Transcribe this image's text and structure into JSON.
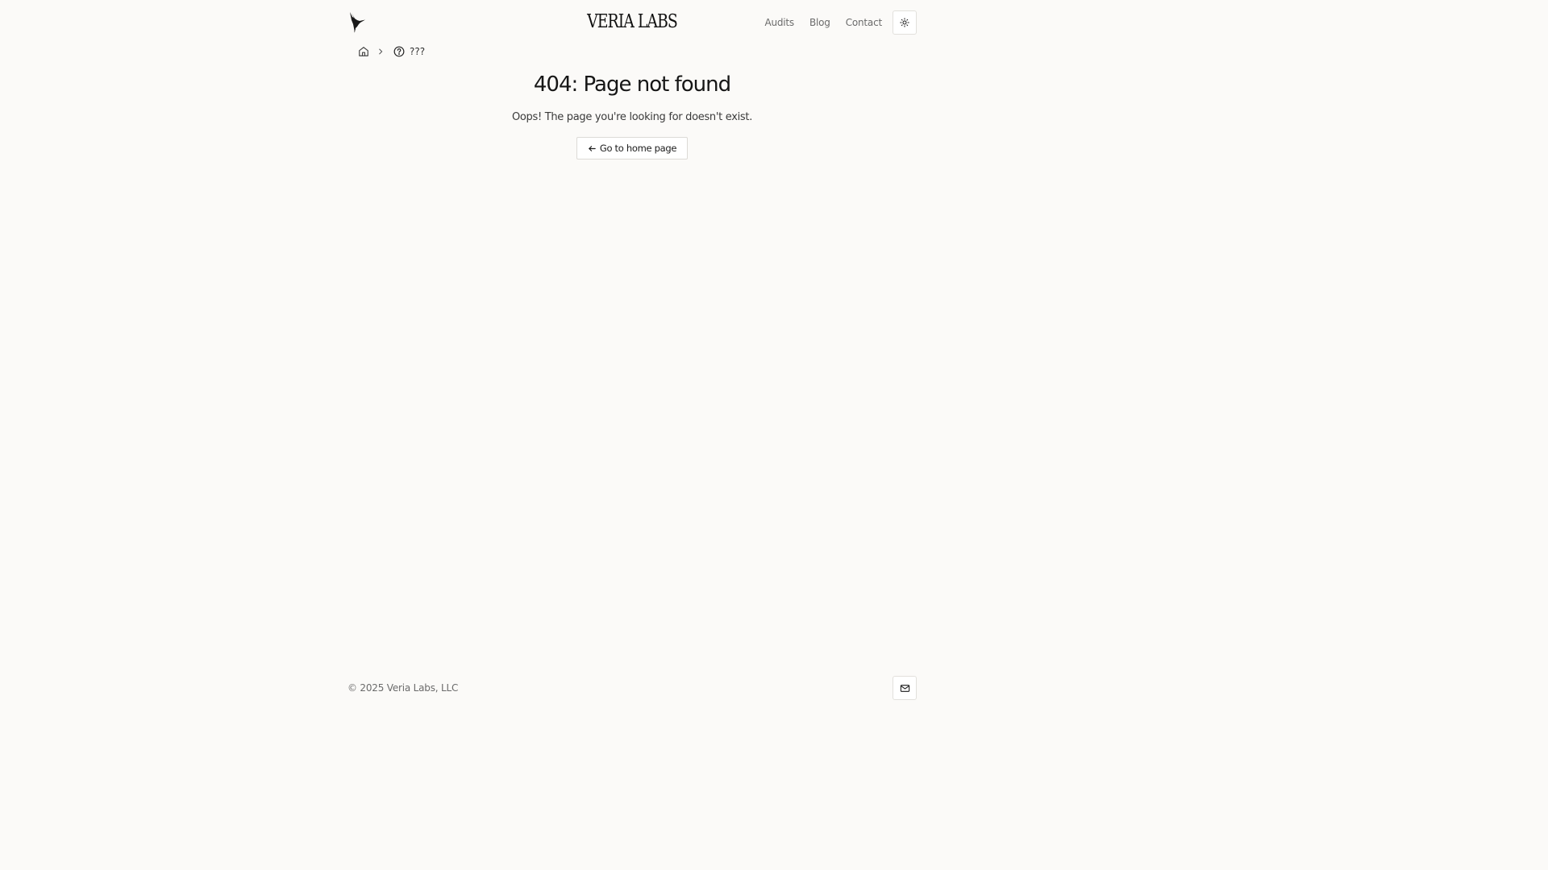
{
  "header": {
    "brand": "VERIA LABS",
    "nav": [
      {
        "label": "Audits"
      },
      {
        "label": "Blog"
      },
      {
        "label": "Contact"
      }
    ],
    "theme_toggle_icon": "sun-icon",
    "logo_icon": "hummingbird-logo"
  },
  "breadcrumb": {
    "home_icon": "home-icon",
    "separator_icon": "chevron-right-icon",
    "current_icon": "question-circle-icon",
    "current_label": "???"
  },
  "main": {
    "title": "404: Page not found",
    "subtitle": "Oops! The page you're looking for doesn't exist.",
    "button_label": "Go to home page",
    "button_icon": "arrow-left-icon"
  },
  "footer": {
    "copyright": "© 2025 Veria Labs, LLC",
    "mail_icon": "mail-icon"
  },
  "colors": {
    "background": "#fbfaf8",
    "text": "#1a1a1a",
    "muted": "#6b6b6b",
    "border": "#e2e0dc"
  }
}
